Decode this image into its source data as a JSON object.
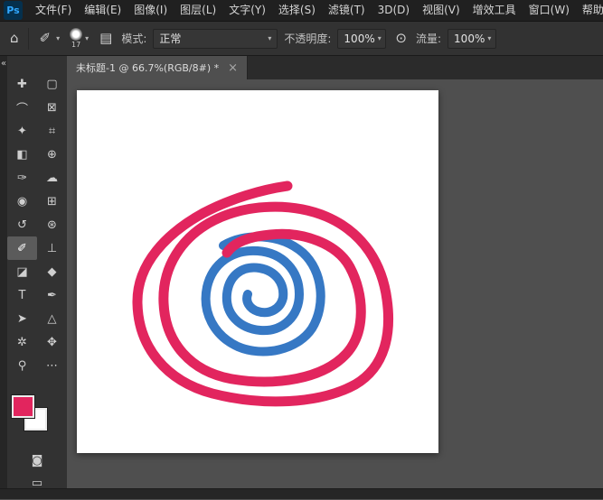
{
  "app": {
    "logo_text": "Ps"
  },
  "menu_bar": {
    "items": [
      {
        "id": "file",
        "label": "文件(F)"
      },
      {
        "id": "edit",
        "label": "编辑(E)"
      },
      {
        "id": "image",
        "label": "图像(I)"
      },
      {
        "id": "layer",
        "label": "图层(L)"
      },
      {
        "id": "type",
        "label": "文字(Y)"
      },
      {
        "id": "select",
        "label": "选择(S)"
      },
      {
        "id": "filter",
        "label": "滤镜(T)"
      },
      {
        "id": "3d",
        "label": "3D(D)"
      },
      {
        "id": "view",
        "label": "视图(V)"
      },
      {
        "id": "plugins",
        "label": "增效工具"
      },
      {
        "id": "window",
        "label": "窗口(W)"
      },
      {
        "id": "help",
        "label": "帮助(H)"
      }
    ]
  },
  "options_bar": {
    "home_icon": "⌂",
    "brush_tool_icon": "✐",
    "brush_size": "17",
    "toggle_panels_icon": "▤",
    "mode_label": "模式:",
    "mode_value": "正常",
    "opacity_label": "不透明度:",
    "opacity_value": "100%",
    "pressure_icon": "⊙",
    "flow_label": "流量:",
    "flow_value": "100%",
    "chevron": "▾"
  },
  "toolbar": {
    "collapse_label": "«",
    "tools": [
      {
        "id": "move",
        "glyph": "✚",
        "selected": false
      },
      {
        "id": "marquee",
        "glyph": "▢",
        "selected": false
      },
      {
        "id": "lasso",
        "glyph": "⌒",
        "selected": false
      },
      {
        "id": "object-selection",
        "glyph": "⊠",
        "selected": false
      },
      {
        "id": "quick-selection",
        "glyph": "✦",
        "selected": false
      },
      {
        "id": "ruler",
        "glyph": "⌗",
        "selected": false
      },
      {
        "id": "gradient",
        "glyph": "◧",
        "selected": false
      },
      {
        "id": "clone-stamp",
        "glyph": "⊕",
        "selected": false
      },
      {
        "id": "eyedropper",
        "glyph": "✑",
        "selected": false
      },
      {
        "id": "mixer-brush",
        "glyph": "☁",
        "selected": false
      },
      {
        "id": "blur",
        "glyph": "◉",
        "selected": false
      },
      {
        "id": "crop",
        "glyph": "⊞",
        "selected": false
      },
      {
        "id": "history-brush",
        "glyph": "↺",
        "selected": false
      },
      {
        "id": "spot-healing",
        "glyph": "⊛",
        "selected": false
      },
      {
        "id": "brush",
        "glyph": "✐",
        "selected": true
      },
      {
        "id": "pattern-stamp",
        "glyph": "⊥",
        "selected": false
      },
      {
        "id": "eraser",
        "glyph": "◪",
        "selected": false
      },
      {
        "id": "paint-bucket",
        "glyph": "◆",
        "selected": false
      },
      {
        "id": "type",
        "glyph": "T",
        "selected": false
      },
      {
        "id": "pen",
        "glyph": "✒",
        "selected": false
      },
      {
        "id": "path-selection",
        "glyph": "➤",
        "selected": false
      },
      {
        "id": "shape",
        "glyph": "△",
        "selected": false
      },
      {
        "id": "rotate-view",
        "glyph": "✲",
        "selected": false
      },
      {
        "id": "hand",
        "glyph": "✥",
        "selected": false
      },
      {
        "id": "zoom",
        "glyph": "⚲",
        "selected": false
      },
      {
        "id": "edit-toolbar",
        "glyph": "⋯",
        "selected": false
      }
    ],
    "foreground_color": "#e2255e",
    "background_color": "#ffffff"
  },
  "document": {
    "tab_title": "未标题-1 @ 66.7%(RGB/8#) *",
    "close_icon": "×"
  },
  "canvas": {
    "background": "#ffffff",
    "strokes": {
      "pink": "#e2255e",
      "blue": "#3678c4"
    }
  }
}
